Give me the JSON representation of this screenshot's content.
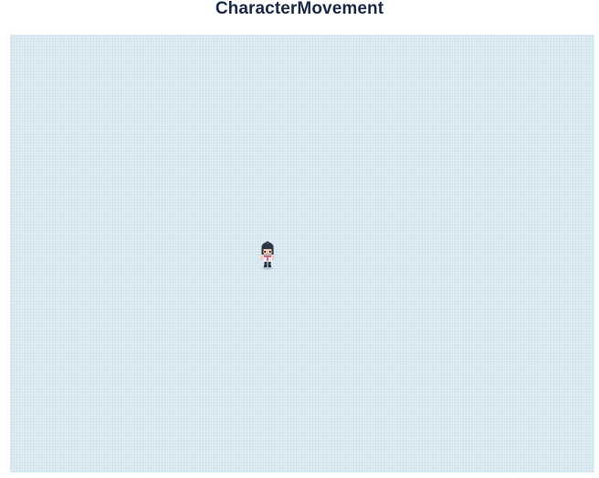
{
  "title": "CharacterMovement",
  "scene": {
    "background_color": "#dcebf3",
    "pattern_color": "#c9dde9",
    "character": {
      "name": "player-character",
      "facing": "down",
      "hair_color": "#2b3440",
      "skin_color": "#f3c9b1",
      "shirt_color": "#f4e6ec",
      "accent_color": "#c46a8d"
    }
  }
}
